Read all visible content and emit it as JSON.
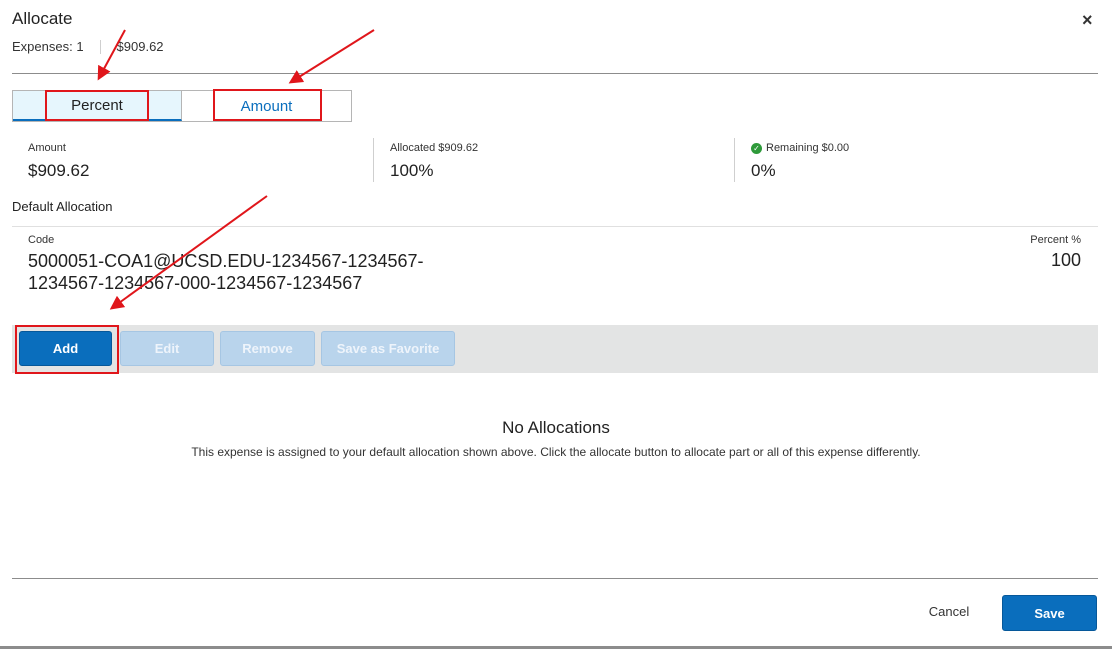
{
  "dialog": {
    "title": "Allocate",
    "close_symbol": "×",
    "expenses_label": "Expenses: 1",
    "expenses_total": "$909.62"
  },
  "toggle": {
    "percent_label": "Percent",
    "amount_label": "Amount",
    "active": "Percent"
  },
  "stats": {
    "amount_label": "Amount",
    "amount_value": "$909.62",
    "allocated_label": "Allocated $909.62",
    "allocated_value": "100%",
    "remaining_label": "Remaining $0.00",
    "remaining_value": "0%",
    "remaining_icon": "check-circle-icon"
  },
  "default_allocation": {
    "section_label": "Default Allocation",
    "code_label": "Code",
    "code_line1": "5000051-COA1@UCSD.EDU-1234567-1234567-",
    "code_line2": "1234567-1234567-000-1234567-1234567",
    "percent_label": "Percent %",
    "percent_value": "100"
  },
  "toolbar": {
    "add_label": "Add",
    "edit_label": "Edit",
    "remove_label": "Remove",
    "favorite_label": "Save as Favorite"
  },
  "empty_state": {
    "title": "No Allocations",
    "description": "This expense is assigned to your default allocation shown above. Click the allocate button to allocate part or all of this expense differently."
  },
  "footer": {
    "cancel_label": "Cancel",
    "save_label": "Save"
  },
  "colors": {
    "primary": "#0a6ebd",
    "primary_disabled": "#b9d4ec",
    "annotation_red": "#e0161b",
    "success_green": "#2e9a3a",
    "toolbar_bg": "#e3e4e4"
  }
}
